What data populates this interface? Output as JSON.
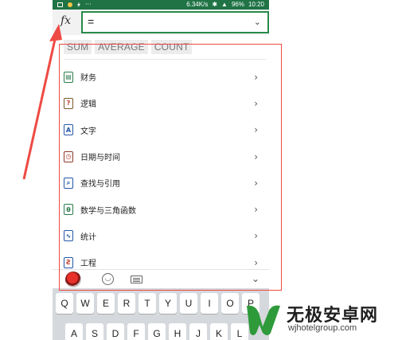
{
  "status_bar": {
    "speed": "6.34K/s",
    "battery": "96%",
    "time": "10:20",
    "dots": "···"
  },
  "formula_bar": {
    "fx_label": "fx",
    "formula_value": "="
  },
  "quick_functions": [
    "SUM",
    "AVERAGE",
    "COUNT"
  ],
  "categories": [
    {
      "label": "财务",
      "icon": "finance-icon",
      "glyph": "▤"
    },
    {
      "label": "逻辑",
      "icon": "logic-icon",
      "glyph": "?"
    },
    {
      "label": "文字",
      "icon": "text-icon",
      "glyph": "A"
    },
    {
      "label": "日期与时间",
      "icon": "datetime-icon",
      "glyph": "◷"
    },
    {
      "label": "查找与引用",
      "icon": "lookup-icon",
      "glyph": "⌕"
    },
    {
      "label": "数学与三角函数",
      "icon": "math-icon",
      "glyph": "θ"
    },
    {
      "label": "统计",
      "icon": "statistics-icon",
      "glyph": "∿"
    },
    {
      "label": "工程",
      "icon": "engineering-icon",
      "glyph": "Ƨ"
    }
  ],
  "keyboard": {
    "row1": [
      "Q",
      "W",
      "E",
      "R",
      "T",
      "Y",
      "U",
      "I",
      "O",
      "P"
    ],
    "row2": [
      "A",
      "S",
      "D",
      "F",
      "G",
      "H",
      "J",
      "K",
      "L"
    ]
  },
  "watermark": {
    "title": "无极安卓网",
    "url": "wjhotelgroup.com"
  },
  "colors": {
    "excel_green": "#1f7345",
    "highlight_red": "#ee4a44"
  }
}
